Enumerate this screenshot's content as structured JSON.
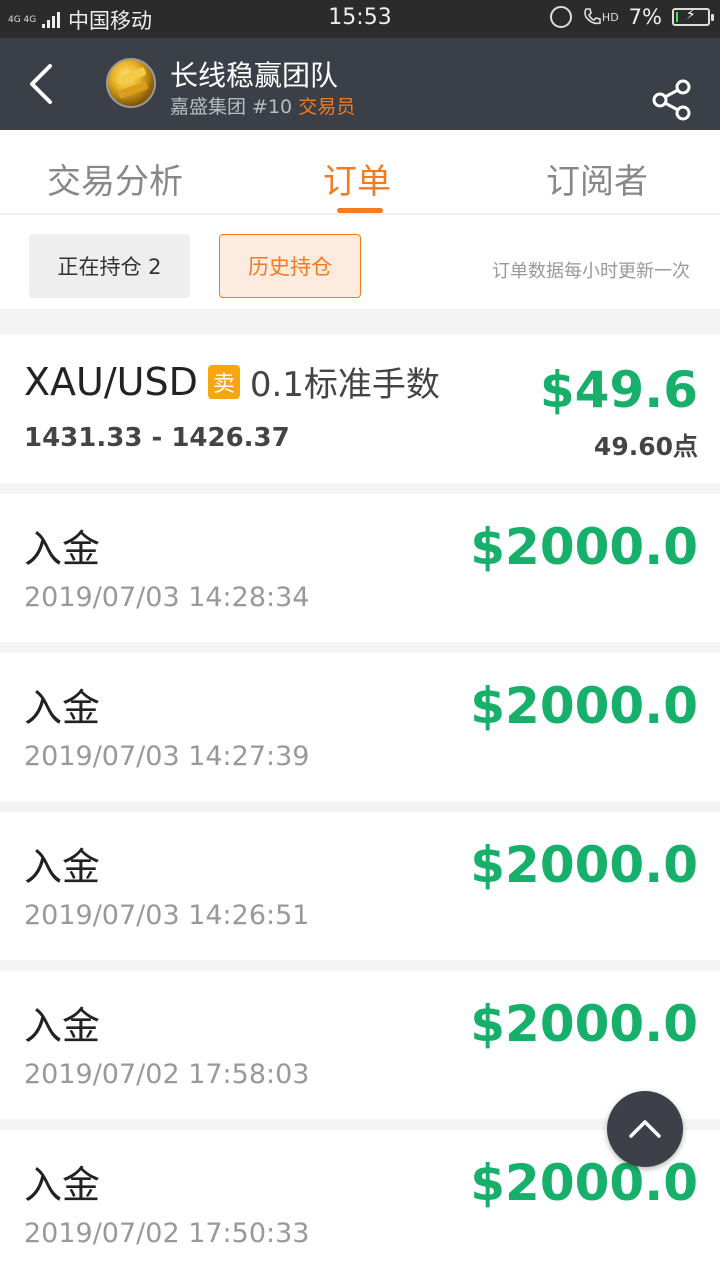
{
  "status_bar": {
    "network": "4G 4G",
    "carrier": "中国移动",
    "time": "15:53",
    "hd": "HD",
    "battery": "7%",
    "battery_level": 0.07
  },
  "header": {
    "team_name": "长线稳赢团队",
    "group": "嘉盛集团 #10",
    "role": "交易员"
  },
  "tabs": [
    {
      "label": "交易分析",
      "active": false
    },
    {
      "label": "订单",
      "active": true
    },
    {
      "label": "订阅者",
      "active": false
    }
  ],
  "filters": {
    "open_positions": "正在持仓 2",
    "history": "历史持仓",
    "note": "订单数据每小时更新一次"
  },
  "position": {
    "symbol": "XAU/USD",
    "side": "卖",
    "lots": "0.1标准手数",
    "range": "1431.33 - 1426.37",
    "profit": "$49.6",
    "points": "49.60点"
  },
  "deposits": [
    {
      "title": "入金",
      "time": "2019/07/03 14:28:34",
      "amount": "$2000.0"
    },
    {
      "title": "入金",
      "time": "2019/07/03 14:27:39",
      "amount": "$2000.0"
    },
    {
      "title": "入金",
      "time": "2019/07/03 14:26:51",
      "amount": "$2000.0"
    },
    {
      "title": "入金",
      "time": "2019/07/02 17:58:03",
      "amount": "$2000.0"
    },
    {
      "title": "入金",
      "time": "2019/07/02 17:50:33",
      "amount": "$2000.0"
    }
  ],
  "colors": {
    "accent": "#f47a1f",
    "profit_green": "#17b06b",
    "header_bg": "#3b3f47",
    "sell_badge": "#f7a60d"
  }
}
